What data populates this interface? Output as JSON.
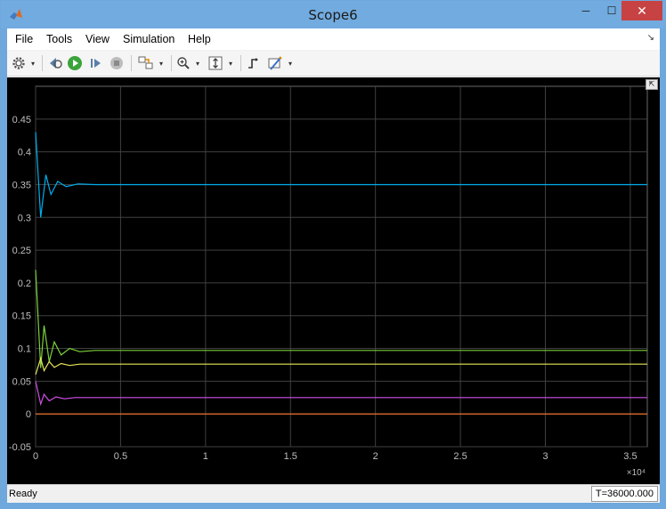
{
  "window": {
    "title": "Scope6",
    "minimize_glyph": "─",
    "maximize_glyph": "☐",
    "close_glyph": "✕"
  },
  "menu": {
    "items": [
      "File",
      "Tools",
      "View",
      "Simulation",
      "Help"
    ],
    "overflow_glyph": "↘"
  },
  "toolbar": {
    "icons": [
      "gear-icon",
      "step-back-icon",
      "run-icon",
      "step-forward-icon",
      "stop-icon",
      "highlight-block-icon",
      "zoom-in-icon",
      "autoscale-icon",
      "triggers-icon",
      "cursor-measure-icon"
    ],
    "caret": "▾"
  },
  "status": {
    "text": "Ready",
    "time": "T=36000.000"
  },
  "undock_glyph": "⇱",
  "colors": {
    "background": "#000000",
    "grid": "#404040",
    "tick_text": "#bfbfbf",
    "title_bar": "#71abdf"
  },
  "chart_data": {
    "type": "line",
    "xlim": [
      0,
      36000
    ],
    "ylim": [
      -0.05,
      0.5
    ],
    "x_tick_labels": [
      "0",
      "0.5",
      "1",
      "1.5",
      "2",
      "2.5",
      "3",
      "3.5"
    ],
    "x_ticks": [
      0,
      5000,
      10000,
      15000,
      20000,
      25000,
      30000,
      35000
    ],
    "x_multiplier": "×10⁴",
    "y_tick_labels": [
      "-0.05",
      "0",
      "0.05",
      "0.1",
      "0.15",
      "0.2",
      "0.25",
      "0.3",
      "0.35",
      "0.4",
      "0.45"
    ],
    "y_ticks": [
      -0.05,
      0,
      0.05,
      0.1,
      0.15,
      0.2,
      0.25,
      0.3,
      0.35,
      0.4,
      0.45
    ],
    "grid": true,
    "series": [
      {
        "color": "#00b0f0",
        "x": [
          0,
          300,
          600,
          900,
          1300,
          1800,
          2500,
          3500,
          36000
        ],
        "y": [
          0.43,
          0.3,
          0.365,
          0.335,
          0.355,
          0.347,
          0.351,
          0.35,
          0.35
        ]
      },
      {
        "color": "#7cd03b",
        "x": [
          0,
          300,
          500,
          800,
          1100,
          1500,
          2000,
          2600,
          3500,
          36000
        ],
        "y": [
          0.22,
          0.07,
          0.135,
          0.08,
          0.11,
          0.09,
          0.1,
          0.095,
          0.097,
          0.097
        ]
      },
      {
        "color": "#e6e65a",
        "x": [
          0,
          300,
          500,
          800,
          1100,
          1500,
          2000,
          2600,
          36000
        ],
        "y": [
          0.06,
          0.085,
          0.066,
          0.08,
          0.071,
          0.077,
          0.074,
          0.076,
          0.076
        ]
      },
      {
        "color": "#d050e8",
        "x": [
          0,
          300,
          500,
          800,
          1200,
          1700,
          2300,
          36000
        ],
        "y": [
          0.05,
          0.015,
          0.03,
          0.02,
          0.026,
          0.023,
          0.025,
          0.025
        ]
      },
      {
        "color": "#ff7a30",
        "x": [
          0,
          36000
        ],
        "y": [
          0.0,
          0.0
        ]
      }
    ]
  }
}
